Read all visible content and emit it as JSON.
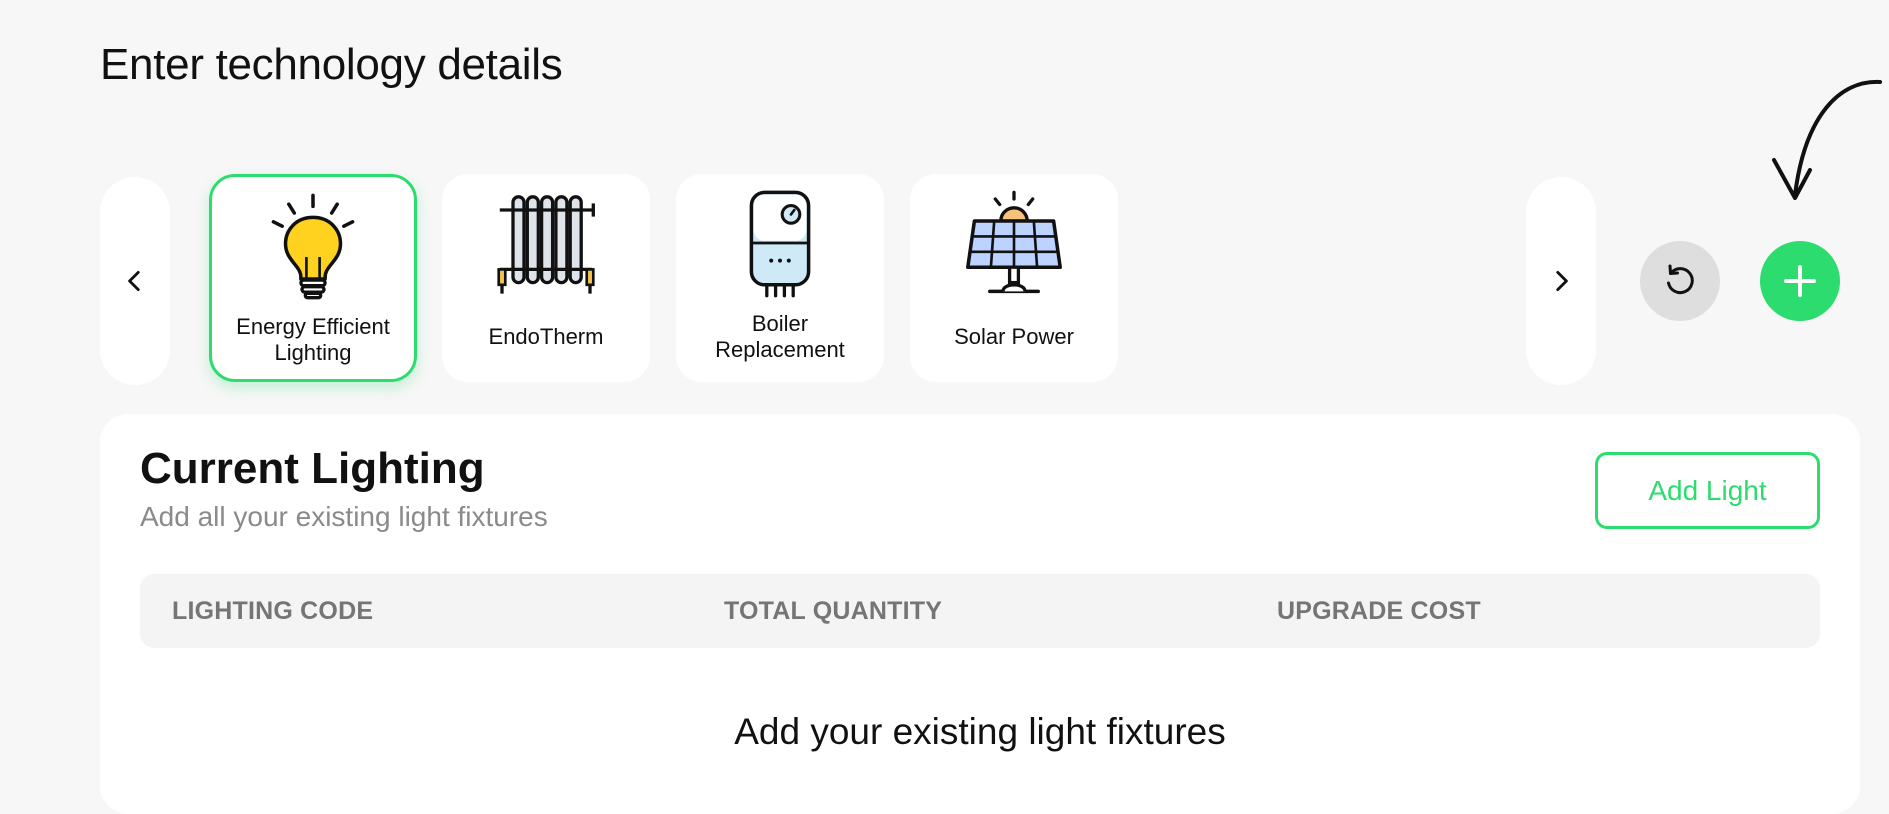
{
  "page": {
    "title": "Enter technology details"
  },
  "technologies": [
    {
      "label": "Energy Efficient Lighting",
      "icon": "light-bulb-icon",
      "selected": true
    },
    {
      "label": "EndoTherm",
      "icon": "radiator-icon",
      "selected": false
    },
    {
      "label": "Boiler Replacement",
      "icon": "boiler-icon",
      "selected": false
    },
    {
      "label": "Solar Power",
      "icon": "solar-panel-icon",
      "selected": false
    }
  ],
  "carousel": {
    "prev_icon": "chevron-left-icon",
    "next_icon": "chevron-right-icon"
  },
  "actions": {
    "reset_icon": "reset-icon",
    "add_icon": "plus-icon"
  },
  "panel": {
    "title": "Current Lighting",
    "subtitle": "Add all your existing light fixtures",
    "add_button_label": "Add Light",
    "columns": [
      "LIGHTING CODE",
      "TOTAL QUANTITY",
      "UPGRADE COST"
    ],
    "empty_title": "Add your existing light fixtures"
  },
  "colors": {
    "accent": "#2ddc6e",
    "background": "#f7f7f7",
    "card": "#ffffff",
    "muted_text": "#8a8a8a",
    "reset_bg": "#dedede"
  }
}
